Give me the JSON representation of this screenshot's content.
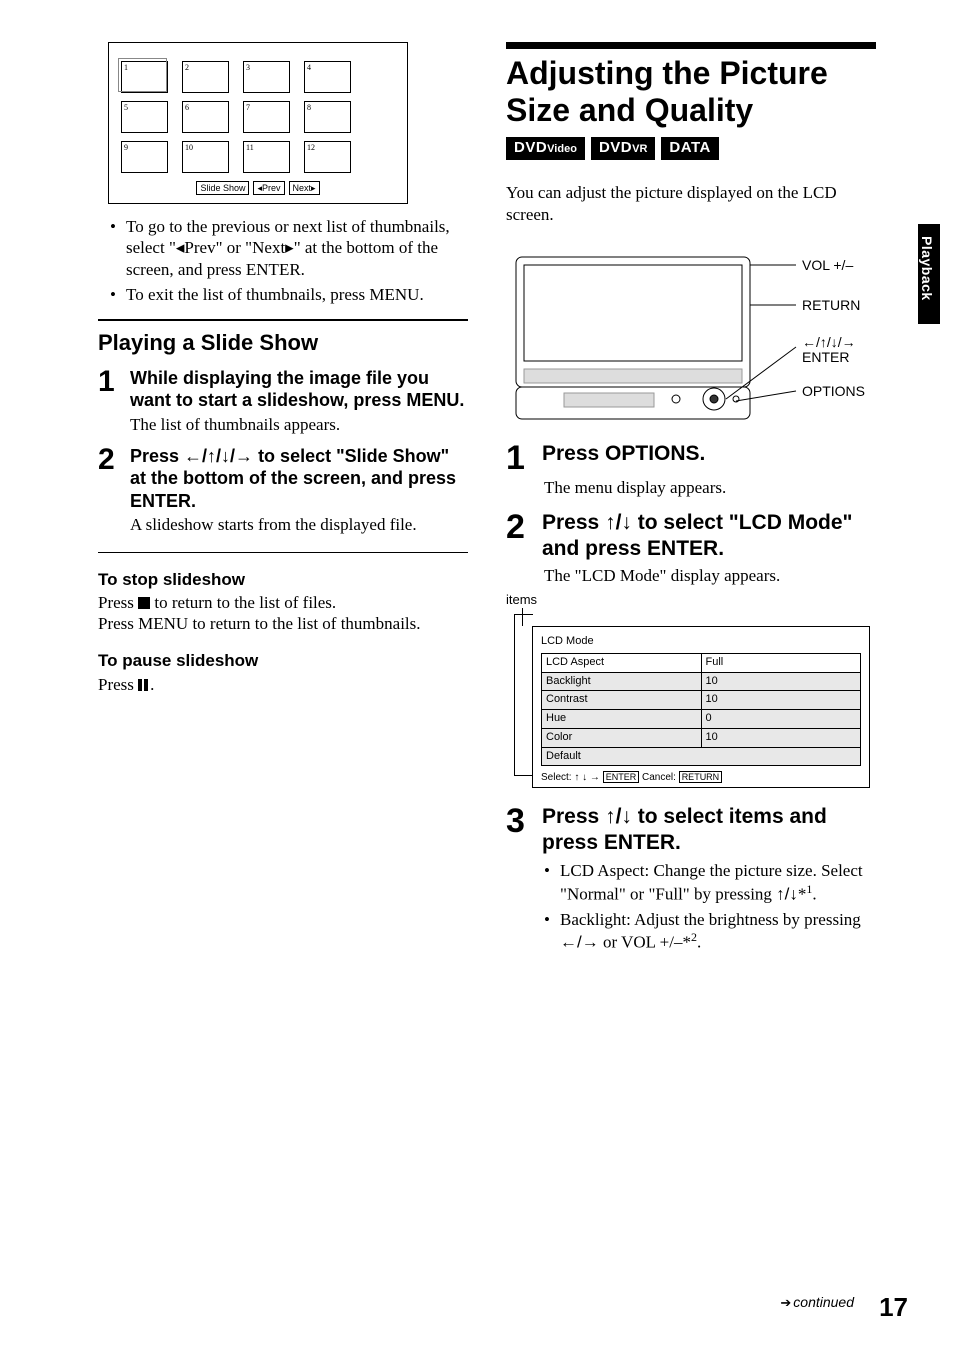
{
  "left": {
    "thumbs": [
      "1",
      "2",
      "3",
      "4",
      "5",
      "6",
      "7",
      "8",
      "9",
      "10",
      "11",
      "12"
    ],
    "thumb_buttons": {
      "slide": "Slide Show",
      "prev": "◂Prev",
      "next": "Next▸"
    },
    "bullets": {
      "a": "To go to the previous or next list of thumbnails, select \"◂Prev\" or \"Next▸\" at the bottom of the screen, and press ENTER.",
      "b": "To exit the list of thumbnails, press MENU."
    },
    "sect": "Playing a Slide Show",
    "step1": {
      "num": "1",
      "head": "While displaying the image file you want to start a slideshow, press MENU.",
      "body": "The list of thumbnails appears."
    },
    "step2": {
      "num": "2",
      "head_a": "Press ",
      "head_arrows": "←/↑/↓/→",
      "head_b": " to select \"Slide Show\" at the bottom of the screen, and press ENTER.",
      "body": "A slideshow starts from the displayed file."
    },
    "stop_h": "To stop slideshow",
    "stop_a": "Press ",
    "stop_b": " to return to the list of files.",
    "stop_c": "Press MENU to return to the list of thumbnails.",
    "pause_h": "To pause slideshow",
    "pause_a": "Press ",
    "pause_b": "."
  },
  "right": {
    "title": "Adjusting the Picture Size and Quality",
    "badges": {
      "a": "DVD",
      "a2": "Video",
      "b": "DVD",
      "b2": "VR",
      "c": "DATA"
    },
    "intro": "You can adjust the picture displayed on the LCD screen.",
    "labels": {
      "vol": "VOL +/–",
      "ret": "RETURN",
      "arrows": "←/↑/↓/→",
      "enter": "ENTER",
      "opt": "OPTIONS"
    },
    "step1": {
      "num": "1",
      "head": "Press OPTIONS.",
      "body": "The menu display appears."
    },
    "step2": {
      "num": "2",
      "head_a": "Press ",
      "head_arrows": "↑/↓",
      "head_b": " to select \"LCD Mode\" and press ENTER.",
      "body": "The \"LCD Mode\" display appears."
    },
    "lcd": {
      "caption": "items",
      "title": "LCD Mode",
      "rows": [
        {
          "k": "LCD Aspect",
          "v": "Full"
        },
        {
          "k": "Backlight",
          "v": "10"
        },
        {
          "k": "Contrast",
          "v": "10"
        },
        {
          "k": "Hue",
          "v": " 0"
        },
        {
          "k": "Color",
          "v": "10"
        },
        {
          "k": "Default",
          "v": ""
        }
      ],
      "foot_a": "Select: ",
      "foot_ar1": "↑ ↓ →",
      "foot_enter": "ENTER",
      "foot_b": " Cancel: ",
      "foot_return": "RETURN"
    },
    "step3": {
      "num": "3",
      "head_a": "Press ",
      "head_arrows": "↑/↓",
      "head_b": " to select items and press ENTER.",
      "li1_a": "LCD Aspect: Change the picture size. Select \"Normal\" or \"Full\" by pressing ",
      "li1_ar": "↑/↓",
      "li1_b": "*",
      "li1_sup": "1",
      "li1_c": ".",
      "li2_a": "Backlight: Adjust the brightness by pressing ",
      "li2_ar": "←/→",
      "li2_b": " or VOL +/–*",
      "li2_sup": "2",
      "li2_c": "."
    }
  },
  "sidetab": "Playback",
  "continued": "continued",
  "pagenum": "17"
}
